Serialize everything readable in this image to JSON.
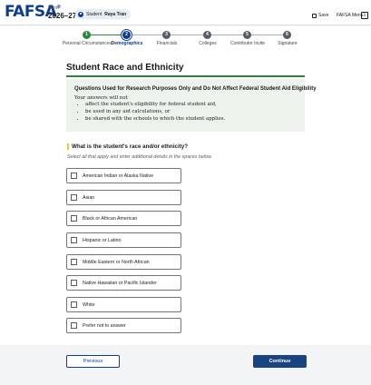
{
  "header": {
    "logo": "FAFSA",
    "logo_mark": "®",
    "form_label": "Form",
    "form_year": "2026–27",
    "student_label": "Student",
    "student_name": "Raya Tran",
    "save_label": "Save",
    "menu_label": "FAFSA Menu",
    "info_label": "i"
  },
  "progress": {
    "steps": [
      {
        "number": "1",
        "label": "Personal Circumstances",
        "state": "done"
      },
      {
        "number": "2",
        "label": "Demographics",
        "state": "current"
      },
      {
        "number": "3",
        "label": "Financials",
        "state": "upcoming"
      },
      {
        "number": "4",
        "label": "Colleges",
        "state": "upcoming"
      },
      {
        "number": "5",
        "label": "Contributor Invite",
        "state": "upcoming"
      },
      {
        "number": "6",
        "label": "Signature",
        "state": "upcoming"
      }
    ]
  },
  "page": {
    "title": "Student Race and Ethnicity",
    "notice": {
      "heading": "Questions Used for Research Purposes Only and Do Not Affect Federal Student Aid Eligibility",
      "intro": "Your answers will not",
      "bullets": [
        "affect the student's eligibility for federal student aid,",
        "be used in any aid calculations, or",
        "be shared with the schools to which the student applies."
      ]
    },
    "question": "What is the student's race and/or ethnicity?",
    "hint": "Select all that apply and enter additional details in the spaces below.",
    "options": [
      "American Indian or Alaska Native",
      "Asian",
      "Black or African American",
      "Hispanic or Latino",
      "Middle Eastern or North African",
      "Native Hawaiian or Pacific Islander",
      "White",
      "Prefer not to answer"
    ]
  },
  "footer": {
    "previous_label": "Previous",
    "continue_label": "Continue"
  },
  "colors": {
    "brand": "#0b3d91",
    "success": "#2e8540",
    "notice_bg": "#ecf3ec",
    "primary_button": "#1a4480"
  }
}
